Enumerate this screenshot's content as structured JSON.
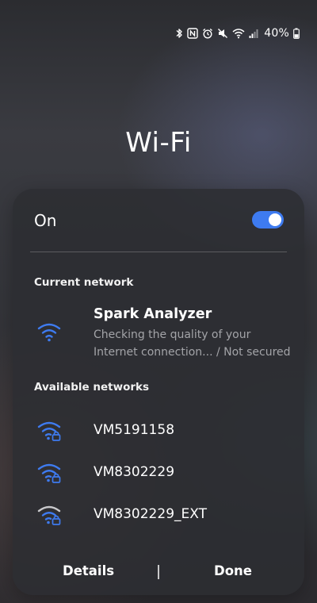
{
  "status_bar": {
    "icons": [
      "bluetooth-icon",
      "nfc-icon",
      "alarm-icon",
      "mute-icon",
      "wifi-icon",
      "signal-icon",
      "battery-icon"
    ],
    "battery": "40%"
  },
  "title": "Wi-Fi",
  "toggle": {
    "label": "On",
    "state": "on",
    "accent": "#3e7bf0"
  },
  "current": {
    "section_title": "Current network",
    "name": "Spark Analyzer",
    "status": "Checking the quality of your Internet connection... / Not secured",
    "icon": "wifi-icon"
  },
  "available": {
    "section_title": "Available networks",
    "networks": [
      {
        "name": "VM5191158",
        "icon": "wifi-lock-icon"
      },
      {
        "name": "VM8302229",
        "icon": "wifi-lock-icon"
      },
      {
        "name": "VM8302229_EXT",
        "icon": "wifi-lock-weak-icon"
      }
    ]
  },
  "footer": {
    "details": "Details",
    "done": "Done"
  }
}
